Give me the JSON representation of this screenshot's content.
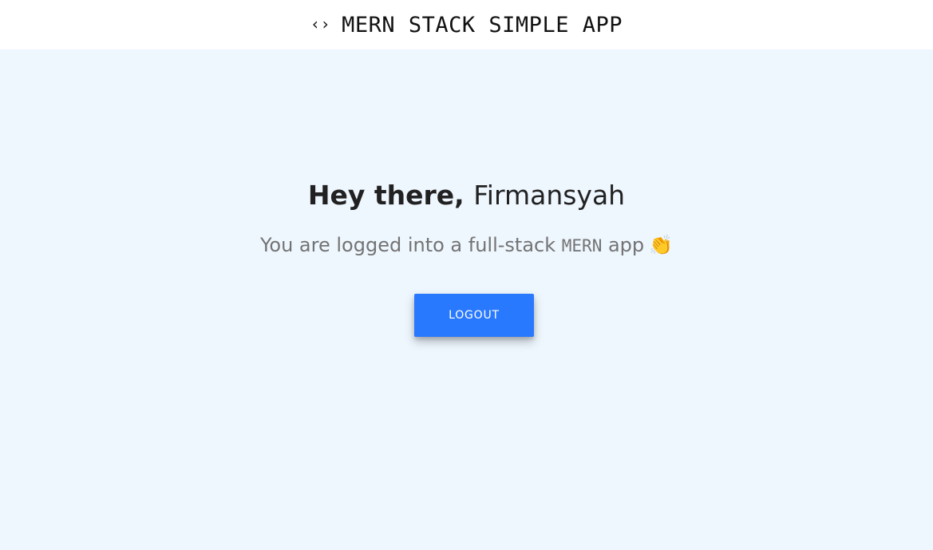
{
  "navbar": {
    "icon": "code-brackets-icon",
    "icon_glyph": "‹›",
    "title": "MERN STACK SIMPLE APP"
  },
  "main": {
    "greeting_prefix": "Hey there,",
    "user_name": "Firmansyah",
    "subtitle_before": "You are logged into a full-stack ",
    "subtitle_code": "MERN",
    "subtitle_after": " app",
    "subtitle_emoji": "👏",
    "logout_label": "LOGOUT"
  },
  "colors": {
    "background": "#eef6fe",
    "navbar": "#ffffff",
    "button": "#2979ff",
    "heading": "#212121",
    "subtitle": "#737373"
  }
}
